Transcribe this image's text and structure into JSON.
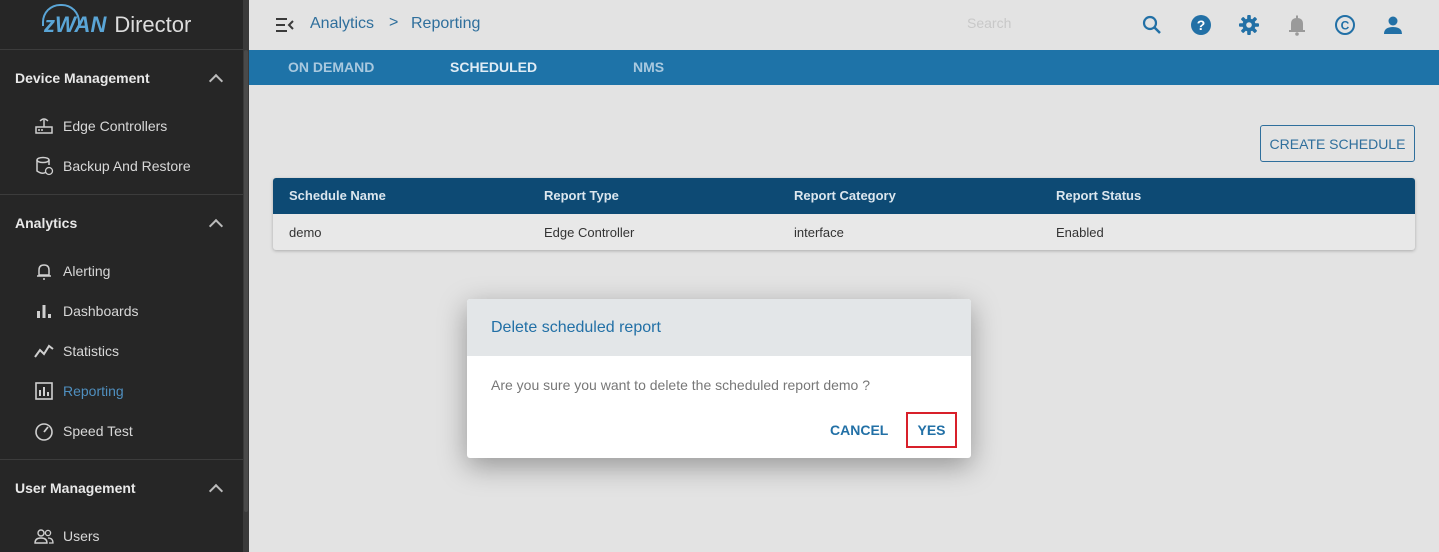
{
  "app": {
    "brand": "zWAN",
    "product": "Director"
  },
  "sidebar": {
    "sections": [
      {
        "title": "Device Management",
        "items": [
          {
            "label": "Edge Controllers",
            "icon": "router-icon"
          },
          {
            "label": "Backup And Restore",
            "icon": "database-restore-icon"
          }
        ]
      },
      {
        "title": "Analytics",
        "items": [
          {
            "label": "Alerting",
            "icon": "bell-icon"
          },
          {
            "label": "Dashboards",
            "icon": "bar-chart-icon"
          },
          {
            "label": "Statistics",
            "icon": "line-chart-icon"
          },
          {
            "label": "Reporting",
            "icon": "report-icon",
            "active": true
          },
          {
            "label": "Speed Test",
            "icon": "speedometer-icon"
          }
        ]
      },
      {
        "title": "User Management",
        "items": [
          {
            "label": "Users",
            "icon": "users-icon"
          }
        ]
      }
    ]
  },
  "header": {
    "breadcrumb": [
      "Analytics",
      "Reporting"
    ],
    "breadcrumb_separator": ">",
    "search_placeholder": "Search",
    "icons": [
      "search-icon",
      "help-icon",
      "gear-icon",
      "bell-icon",
      "copyright-icon",
      "account-icon"
    ]
  },
  "tabs": [
    {
      "label": "ON DEMAND"
    },
    {
      "label": "SCHEDULED",
      "selected": true
    },
    {
      "label": "NMS"
    }
  ],
  "main": {
    "create_button": "CREATE SCHEDULE",
    "table": {
      "columns": [
        "Schedule Name",
        "Report Type",
        "Report Category",
        "Report Status"
      ],
      "rows": [
        [
          "demo",
          "Edge Controller",
          "interface",
          "Enabled"
        ]
      ]
    }
  },
  "dialog": {
    "title": "Delete scheduled report",
    "message": "Are you sure you want to delete the scheduled report demo ?",
    "cancel_label": "CANCEL",
    "yes_label": "YES"
  },
  "colors": {
    "sidebar_bg": "#262626",
    "tab_bar": "#1e73a8",
    "table_header": "#0d4a74",
    "accent": "#2270a6",
    "highlight_border": "#d8202a"
  }
}
